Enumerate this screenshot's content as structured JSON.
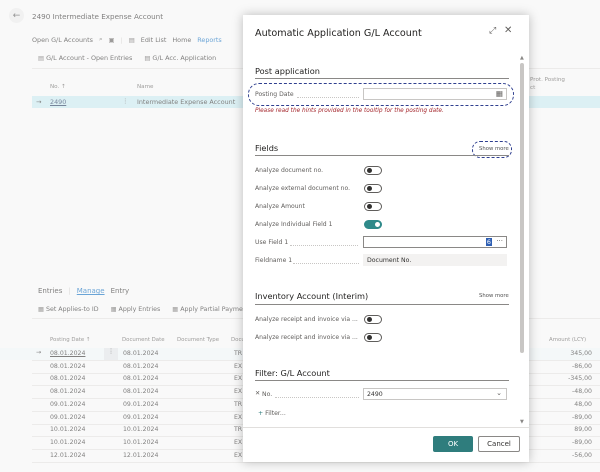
{
  "page": {
    "title": "2490 Intermediate Expense Account"
  },
  "actions": {
    "top": [
      "Open G/L Accounts",
      "Edit List",
      "Home",
      "Reports"
    ],
    "second": [
      "G/L Account - Open Entries",
      "G/L Acc. Application"
    ]
  },
  "list": {
    "col_no": "No. ↑",
    "col_name": "Name",
    "col_prot": "Prot. Posting",
    "col_prot2": "ct",
    "row_no": "2490",
    "row_name": "Intermediate Expense Account"
  },
  "entries": {
    "tabs": [
      "Entries",
      "Manage",
      "Entry"
    ],
    "actions": [
      "Set Applies-to ID",
      "Apply Entries",
      "Apply Partial Paymen"
    ],
    "headers": [
      "Posting Date ↑",
      "Document Date",
      "Document Type",
      "Docu",
      "Amount (LCY)"
    ],
    "rows": [
      {
        "posting": "08.01.2024",
        "doc": "08.01.2024",
        "type": "TR",
        "amount": "345,00"
      },
      {
        "posting": "08.01.2024",
        "doc": "08.01.2024",
        "type": "EX",
        "amount": "-86,00"
      },
      {
        "posting": "08.01.2024",
        "doc": "08.01.2024",
        "type": "EX",
        "amount": "-345,00"
      },
      {
        "posting": "08.01.2024",
        "doc": "08.01.2024",
        "type": "EX",
        "amount": "-48,00"
      },
      {
        "posting": "09.01.2024",
        "doc": "09.01.2024",
        "type": "TR",
        "amount": "48,00"
      },
      {
        "posting": "09.01.2024",
        "doc": "09.01.2024",
        "type": "EX",
        "amount": "-89,00"
      },
      {
        "posting": "10.01.2024",
        "doc": "10.01.2024",
        "type": "TR",
        "amount": "89,00"
      },
      {
        "posting": "10.01.2024",
        "doc": "10.01.2024",
        "type": "EX",
        "amount": "-89,00"
      },
      {
        "posting": "12.01.2024",
        "doc": "12.01.2024",
        "type": "EX",
        "amount": "-56,00"
      }
    ]
  },
  "dialog": {
    "title": "Automatic Application G/L Account",
    "post_section": "Post application",
    "posting_date_label": "Posting Date",
    "hint": "Please read the hints provided in the tooltip for the posting date.",
    "fields_section": "Fields",
    "show_more": "Show more",
    "toggles": [
      {
        "label": "Analyze document no.",
        "on": false
      },
      {
        "label": "Analyze external document no.",
        "on": false
      },
      {
        "label": "Analyze Amount",
        "on": false
      },
      {
        "label": "Analyze Individual Field 1",
        "on": true
      }
    ],
    "use_field_label": "Use Field 1",
    "use_field_value": "6",
    "fieldname_label": "Fieldname 1",
    "fieldname_value": "Document No.",
    "inventory_section": "Inventory Account (Interim)",
    "inv_toggles": [
      {
        "label": "Analyze receipt and invoice via ...",
        "on": false
      },
      {
        "label": "Analyze receipt and invoice via ...",
        "on": false
      }
    ],
    "filter_section": "Filter: G/L Account",
    "filter_field": "No.",
    "filter_value": "2490",
    "add_filter": "Filter...",
    "ok": "OK",
    "cancel": "Cancel"
  },
  "colors": {
    "accent": "#2f7d7d",
    "highlight_row": "#c7e7ee",
    "focus_outline": "#2f3f8f",
    "hint": "#a4262c"
  }
}
